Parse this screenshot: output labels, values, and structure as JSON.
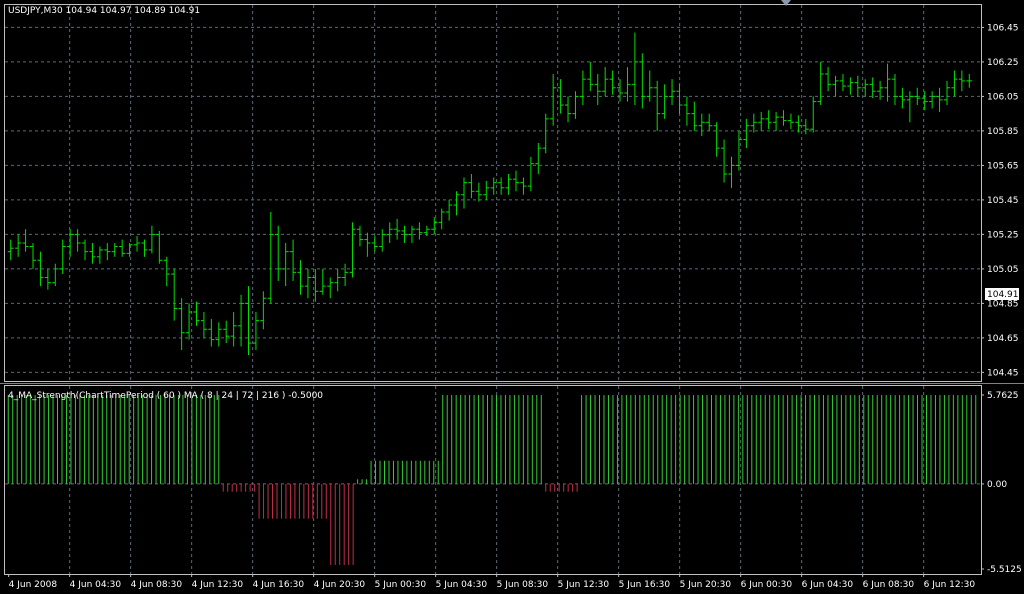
{
  "colors": {
    "background": "#000000",
    "grid": "#5a6a7a",
    "frame": "#c0c0c0",
    "bar": "#00e000",
    "bull": "#32cd32",
    "bear": "#c0304a",
    "text": "#ffffff",
    "price_tag_bg": "#ffffff",
    "price_tag_text": "#000000"
  },
  "main_pane": {
    "header": "USDJPY,M30  104.94 104.97 104.89 104.91",
    "current_price": "104.91"
  },
  "indicator_pane": {
    "header": "4_MA_Strength(ChartTimePeriod ( 60 ) MA ( 8 | 24 | 72 | 216 ) -0.5000"
  },
  "chart_data": [
    {
      "type": "ohlc",
      "symbol": "USDJPY",
      "timeframe": "M30",
      "ylim": [
        104.4,
        106.58
      ],
      "y_ticks": [
        "106.45",
        "106.25",
        "106.05",
        "105.85",
        "105.65",
        "105.45",
        "105.25",
        "105.05",
        "104.85",
        "104.65",
        "104.45"
      ],
      "bars": [
        [
          105.15,
          105.22,
          105.1,
          105.17
        ],
        [
          105.17,
          105.25,
          105.12,
          105.2
        ],
        [
          105.2,
          105.28,
          105.15,
          105.18
        ],
        [
          105.18,
          105.2,
          105.05,
          105.1
        ],
        [
          105.1,
          105.15,
          104.95,
          105.0
        ],
        [
          105.0,
          105.05,
          104.93,
          104.97
        ],
        [
          104.97,
          105.08,
          104.95,
          105.05
        ],
        [
          105.05,
          105.22,
          105.02,
          105.18
        ],
        [
          105.18,
          105.28,
          105.12,
          105.25
        ],
        [
          105.25,
          105.28,
          105.15,
          105.2
        ],
        [
          105.2,
          105.22,
          105.1,
          105.15
        ],
        [
          105.15,
          105.2,
          105.08,
          105.12
        ],
        [
          105.12,
          105.18,
          105.08,
          105.16
        ],
        [
          105.16,
          105.2,
          105.1,
          105.15
        ],
        [
          105.15,
          105.2,
          105.12,
          105.18
        ],
        [
          105.18,
          105.22,
          105.12,
          105.14
        ],
        [
          105.14,
          105.2,
          105.12,
          105.19
        ],
        [
          105.19,
          105.24,
          105.15,
          105.2
        ],
        [
          105.2,
          105.22,
          105.12,
          105.16
        ],
        [
          105.16,
          105.3,
          105.14,
          105.25
        ],
        [
          105.25,
          105.27,
          105.08,
          105.1
        ],
        [
          105.1,
          105.12,
          104.95,
          105.02
        ],
        [
          105.02,
          105.05,
          104.75,
          104.82
        ],
        [
          104.82,
          104.88,
          104.58,
          104.68
        ],
        [
          104.68,
          104.85,
          104.64,
          104.8
        ],
        [
          104.8,
          104.86,
          104.72,
          104.75
        ],
        [
          104.75,
          104.8,
          104.65,
          104.7
        ],
        [
          104.7,
          104.76,
          104.6,
          104.64
        ],
        [
          104.64,
          104.74,
          104.6,
          104.7
        ],
        [
          104.7,
          104.75,
          104.62,
          104.66
        ],
        [
          104.66,
          104.8,
          104.6,
          104.72
        ],
        [
          104.72,
          104.9,
          104.6,
          104.85
        ],
        [
          104.85,
          104.95,
          104.55,
          104.62
        ],
        [
          104.62,
          104.8,
          104.58,
          104.75
        ],
        [
          104.75,
          104.92,
          104.7,
          104.88
        ],
        [
          104.88,
          105.38,
          104.85,
          105.25
        ],
        [
          105.25,
          105.3,
          104.98,
          105.05
        ],
        [
          105.05,
          105.2,
          104.95,
          105.15
        ],
        [
          105.15,
          105.22,
          104.98,
          105.03
        ],
        [
          105.03,
          105.1,
          104.9,
          104.95
        ],
        [
          104.95,
          105.05,
          104.88,
          105.0
        ],
        [
          105.0,
          105.05,
          104.86,
          104.92
        ],
        [
          104.92,
          105.05,
          104.9,
          104.95
        ],
        [
          104.95,
          105.0,
          104.88,
          104.97
        ],
        [
          104.97,
          105.05,
          104.92,
          105.0
        ],
        [
          105.0,
          105.08,
          104.95,
          105.03
        ],
        [
          105.03,
          105.32,
          105.0,
          105.28
        ],
        [
          105.28,
          105.3,
          105.18,
          105.22
        ],
        [
          105.22,
          105.26,
          105.12,
          105.2
        ],
        [
          105.2,
          105.24,
          105.15,
          105.18
        ],
        [
          105.18,
          105.28,
          105.15,
          105.25
        ],
        [
          105.25,
          105.32,
          105.2,
          105.28
        ],
        [
          105.28,
          105.34,
          105.22,
          105.27
        ],
        [
          105.27,
          105.3,
          105.2,
          105.25
        ],
        [
          105.25,
          105.3,
          105.2,
          105.28
        ],
        [
          105.28,
          105.32,
          105.22,
          105.26
        ],
        [
          105.26,
          105.3,
          105.24,
          105.28
        ],
        [
          105.28,
          105.35,
          105.25,
          105.32
        ],
        [
          105.32,
          105.4,
          105.28,
          105.38
        ],
        [
          105.38,
          105.45,
          105.33,
          105.42
        ],
        [
          105.42,
          105.5,
          105.36,
          105.48
        ],
        [
          105.48,
          105.58,
          105.4,
          105.55
        ],
        [
          105.55,
          105.6,
          105.46,
          105.5
        ],
        [
          105.5,
          105.55,
          105.44,
          105.48
        ],
        [
          105.48,
          105.56,
          105.45,
          105.52
        ],
        [
          105.52,
          105.58,
          105.48,
          105.55
        ],
        [
          105.55,
          105.58,
          105.48,
          105.52
        ],
        [
          105.52,
          105.6,
          105.48,
          105.57
        ],
        [
          105.57,
          105.62,
          105.5,
          105.55
        ],
        [
          105.55,
          105.58,
          105.48,
          105.53
        ],
        [
          105.53,
          105.7,
          105.5,
          105.66
        ],
        [
          105.66,
          105.78,
          105.6,
          105.75
        ],
        [
          105.75,
          105.95,
          105.72,
          105.92
        ],
        [
          105.92,
          106.18,
          105.88,
          106.1
        ],
        [
          106.1,
          106.15,
          105.95,
          106.0
        ],
        [
          106.0,
          106.05,
          105.9,
          105.95
        ],
        [
          105.95,
          106.08,
          105.92,
          106.05
        ],
        [
          106.05,
          106.2,
          106.0,
          106.15
        ],
        [
          106.15,
          106.25,
          106.08,
          106.12
        ],
        [
          106.12,
          106.18,
          106.0,
          106.08
        ],
        [
          106.08,
          106.22,
          106.05,
          106.15
        ],
        [
          106.15,
          106.2,
          106.06,
          106.1
        ],
        [
          106.1,
          106.15,
          106.02,
          106.07
        ],
        [
          106.07,
          106.22,
          106.02,
          106.12
        ],
        [
          106.12,
          106.42,
          106.0,
          106.25
        ],
        [
          106.25,
          106.3,
          105.98,
          106.05
        ],
        [
          106.05,
          106.2,
          106.02,
          106.1
        ],
        [
          106.1,
          106.14,
          105.85,
          105.95
        ],
        [
          105.95,
          106.12,
          105.92,
          106.05
        ],
        [
          106.05,
          106.15,
          106.0,
          106.08
        ],
        [
          106.08,
          106.12,
          105.95,
          106.0
        ],
        [
          106.0,
          106.05,
          105.88,
          105.95
        ],
        [
          105.95,
          106.02,
          105.85,
          105.88
        ],
        [
          105.88,
          105.95,
          105.82,
          105.9
        ],
        [
          105.9,
          105.95,
          105.85,
          105.88
        ],
        [
          105.88,
          105.9,
          105.7,
          105.75
        ],
        [
          105.75,
          105.8,
          105.55,
          105.6
        ],
        [
          105.6,
          105.7,
          105.52,
          105.65
        ],
        [
          105.65,
          105.85,
          105.62,
          105.8
        ],
        [
          105.8,
          105.92,
          105.75,
          105.88
        ],
        [
          105.88,
          105.95,
          105.84,
          105.9
        ],
        [
          105.9,
          105.96,
          105.85,
          105.92
        ],
        [
          105.92,
          105.97,
          105.86,
          105.9
        ],
        [
          105.9,
          105.96,
          105.85,
          105.93
        ],
        [
          105.93,
          105.97,
          105.88,
          105.91
        ],
        [
          105.91,
          105.95,
          105.86,
          105.9
        ],
        [
          105.9,
          105.94,
          105.84,
          105.88
        ],
        [
          105.88,
          105.92,
          105.83,
          105.86
        ],
        [
          105.86,
          106.05,
          105.84,
          106.02
        ],
        [
          106.02,
          106.25,
          106.0,
          106.18
        ],
        [
          106.18,
          106.22,
          106.08,
          106.12
        ],
        [
          106.12,
          106.17,
          106.05,
          106.14
        ],
        [
          106.14,
          106.18,
          106.08,
          106.11
        ],
        [
          106.11,
          106.16,
          106.06,
          106.13
        ],
        [
          106.13,
          106.17,
          106.05,
          106.1
        ],
        [
          106.1,
          106.15,
          106.05,
          106.12
        ],
        [
          106.12,
          106.16,
          106.04,
          106.08
        ],
        [
          106.08,
          106.14,
          106.03,
          106.1
        ],
        [
          106.1,
          106.24,
          106.02,
          106.15
        ],
        [
          106.15,
          106.18,
          106.0,
          106.05
        ],
        [
          106.05,
          106.1,
          105.98,
          106.03
        ],
        [
          106.03,
          106.08,
          105.9,
          106.05
        ],
        [
          106.05,
          106.1,
          106.0,
          106.04
        ],
        [
          106.04,
          106.08,
          105.97,
          106.02
        ],
        [
          106.02,
          106.08,
          105.98,
          106.05
        ],
        [
          106.05,
          106.1,
          105.96,
          106.03
        ],
        [
          106.03,
          106.14,
          106.0,
          106.1
        ],
        [
          106.1,
          106.2,
          106.05,
          106.15
        ],
        [
          106.15,
          106.2,
          106.08,
          106.14
        ],
        [
          106.14,
          106.18,
          106.1,
          106.14
        ]
      ]
    },
    {
      "type": "histogram",
      "ylim": [
        -5.5125,
        5.7625
      ],
      "y_ticks": [
        "5.7625",
        "0.00",
        "-5.5125"
      ],
      "values": [
        5.76,
        5.76,
        5.76,
        5.76,
        5.76,
        5.76,
        5.76,
        5.76,
        5.76,
        5.76,
        5.76,
        5.76,
        5.76,
        5.76,
        5.76,
        5.76,
        5.76,
        5.76,
        5.76,
        5.76,
        5.76,
        5.76,
        5.76,
        5.76,
        5.76,
        5.76,
        5.76,
        5.76,
        5.76,
        5.76,
        5.76,
        5.76,
        5.76,
        5.76,
        5.76,
        5.76,
        5.76,
        5.76,
        5.76,
        5.76,
        5.76,
        5.76,
        5.76,
        5.76,
        5.76,
        5.76,
        5.76,
        5.76,
        -0.5,
        -0.5,
        -0.5,
        -0.5,
        -0.5,
        -0.5,
        -0.5,
        -0.5,
        -2.25,
        -2.25,
        -2.25,
        -2.25,
        -2.25,
        -2.25,
        -2.25,
        -2.25,
        -2.25,
        -2.25,
        -2.25,
        -2.25,
        -2.25,
        -2.25,
        -2.25,
        -2.25,
        -5.25,
        -5.25,
        -5.25,
        -5.25,
        -5.25,
        -5.25,
        0.3,
        0.3,
        0.3,
        1.5,
        1.5,
        1.5,
        1.5,
        1.5,
        1.5,
        1.5,
        1.5,
        1.5,
        1.5,
        1.5,
        1.5,
        1.5,
        1.5,
        1.5,
        1.5,
        5.76,
        5.76,
        5.76,
        5.76,
        5.76,
        5.76,
        5.76,
        5.76,
        5.76,
        5.76,
        5.76,
        5.76,
        5.76,
        5.76,
        5.76,
        5.76,
        5.76,
        5.76,
        5.76,
        5.76,
        5.76,
        5.76,
        5.76,
        -0.5,
        -0.5,
        -0.5,
        -0.5,
        -0.5,
        -0.5,
        -0.5,
        -0.5,
        5.76,
        5.76,
        5.76,
        5.76,
        5.76,
        5.76,
        5.76,
        5.76,
        5.76,
        5.76,
        5.76,
        5.76,
        5.76,
        5.76,
        5.76,
        5.76,
        5.76,
        5.76,
        5.76,
        5.76,
        5.76,
        5.76,
        5.76,
        5.76,
        5.76,
        5.76,
        5.76,
        5.76,
        5.76,
        5.76,
        5.76,
        5.76,
        5.76,
        5.76,
        5.76,
        5.76,
        5.76,
        5.76,
        5.76,
        5.76,
        5.76,
        5.76,
        5.76,
        5.76,
        5.76,
        5.76,
        5.76,
        5.76,
        5.76,
        5.76,
        5.76,
        5.76,
        5.76,
        5.76,
        5.76,
        5.76,
        5.76,
        5.76,
        5.76,
        5.76,
        5.76,
        5.76,
        5.76,
        5.76,
        5.76,
        5.76,
        5.76,
        5.76,
        5.76,
        5.76,
        5.76,
        5.76,
        5.76,
        5.76,
        5.76,
        5.76,
        5.76,
        5.76,
        5.76,
        5.76,
        5.76,
        5.76,
        5.76,
        5.76,
        5.76,
        5.76,
        5.76,
        5.76,
        5.76
      ]
    }
  ],
  "x_labels": [
    "4 Jun 2008",
    "4 Jun 04:30",
    "4 Jun 08:30",
    "4 Jun 12:30",
    "4 Jun 16:30",
    "4 Jun 20:30",
    "5 Jun 00:30",
    "5 Jun 04:30",
    "5 Jun 08:30",
    "5 Jun 12:30",
    "5 Jun 16:30",
    "5 Jun 20:30",
    "6 Jun 00:30",
    "6 Jun 04:30",
    "6 Jun 08:30",
    "6 Jun 12:30"
  ]
}
